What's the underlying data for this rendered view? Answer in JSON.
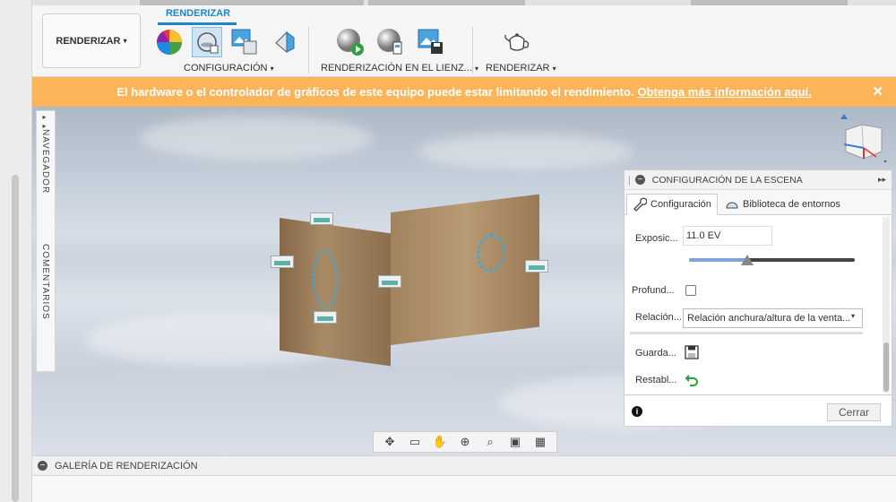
{
  "ribbon": {
    "workspace_label": "RENDERIZAR",
    "workspace_caret": "▾",
    "tab_label": "RENDERIZAR",
    "groups": [
      {
        "label": "CONFIGURACIÓN",
        "caret": "▾"
      },
      {
        "label": "RENDERIZACIÓN EN EL LIENZ...",
        "caret": "▾"
      },
      {
        "label": "RENDERIZAR",
        "caret": "▾"
      }
    ],
    "tools": [
      {
        "name": "appearance-icon"
      },
      {
        "name": "scene-settings-icon"
      },
      {
        "name": "texture-map-icon"
      },
      {
        "name": "decal-icon"
      },
      {
        "name": "in-canvas-render-icon"
      },
      {
        "name": "in-canvas-render-settings-icon"
      },
      {
        "name": "capture-image-icon"
      },
      {
        "name": "render-teapot-icon"
      }
    ]
  },
  "banner": {
    "text": "El hardware o el controlador de gráficos de este equipo puede estar limitando el rendimiento.",
    "link": "Obtenga más información aquí.",
    "close": "✕"
  },
  "sidenav": {
    "navigator_label": "NAVEGADOR",
    "comments_label": "COMENTARIOS",
    "expand": "▸▸"
  },
  "scene_panel": {
    "title": "CONFIGURACIÓN DE LA ESCENA",
    "expand": "▸▸",
    "tabs": [
      {
        "label": "Configuración"
      },
      {
        "label": "Biblioteca de entornos"
      }
    ],
    "exposure_label": "Exposic...",
    "exposure_value": "11.0 EV",
    "exposure_slider": 0.35,
    "depth_label": "Profund...",
    "depth_checked": false,
    "ratio_label": "Relación...",
    "ratio_value": "Relación anchura/altura de la venta...",
    "ratio_caret": "▾",
    "save_label": "Guarda...",
    "reset_label": "Restabl...",
    "info": "i",
    "close_label": "Cerrar"
  },
  "gallery": {
    "label": "GALERÍA DE RENDERIZACIÓN",
    "toggle": "−"
  },
  "colors": {
    "accent": "#1d87c9",
    "banner": "#fbb45a"
  }
}
